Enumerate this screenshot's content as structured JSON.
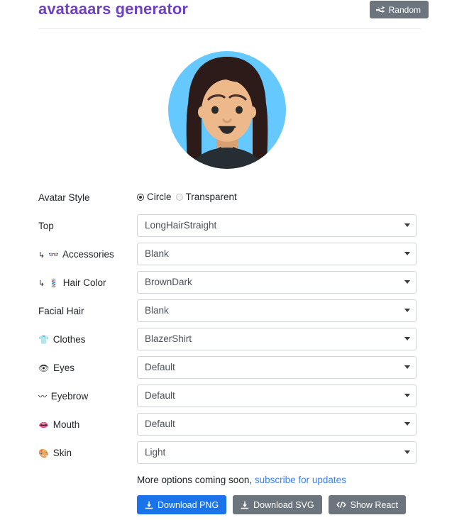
{
  "header": {
    "title": "avataaars generator",
    "random_button": {
      "label": "Random",
      "icon": "shuffle-icon",
      "bg": "#6c757d"
    },
    "title_color": "#6f42c1"
  },
  "avatar": {
    "alt": "generated avatar preview",
    "background_color": "#65C9FF",
    "skin_color": "#EDB98A",
    "hair_color": "#2C1B18",
    "clothes_color": "#262E33"
  },
  "form": {
    "rows": [
      {
        "id": "avatar-style",
        "label": "Avatar Style",
        "icon": "",
        "sub": false,
        "type": "radio",
        "options": [
          "Circle",
          "Transparent"
        ],
        "value": "Circle"
      },
      {
        "id": "top",
        "label": "Top",
        "icon": "",
        "sub": false,
        "type": "select",
        "value": "LongHairStraight"
      },
      {
        "id": "accessories",
        "label": "Accessories",
        "icon": "👓",
        "icon_name": "glasses-icon",
        "sub": true,
        "type": "select",
        "value": "Blank"
      },
      {
        "id": "hair-color",
        "label": "Hair Color",
        "icon": "💈",
        "icon_name": "hair-color-icon",
        "sub": true,
        "type": "select",
        "value": "BrownDark"
      },
      {
        "id": "facial-hair",
        "label": "Facial Hair",
        "icon": "",
        "sub": false,
        "type": "select",
        "value": "Blank"
      },
      {
        "id": "clothes",
        "label": "Clothes",
        "icon": "👕",
        "icon_name": "shirt-icon",
        "sub": false,
        "type": "select",
        "value": "BlazerShirt"
      },
      {
        "id": "eyes",
        "label": "Eyes",
        "icon": "👁",
        "icon_name": "eye-icon",
        "sub": false,
        "type": "select",
        "value": "Default"
      },
      {
        "id": "eyebrow",
        "label": "Eyebrow",
        "icon": "〰",
        "icon_name": "eyebrow-icon",
        "sub": false,
        "type": "select",
        "value": "Default"
      },
      {
        "id": "mouth",
        "label": "Mouth",
        "icon": "👄",
        "icon_name": "mouth-icon",
        "sub": false,
        "type": "select",
        "value": "Default"
      },
      {
        "id": "skin",
        "label": "Skin",
        "icon": "🎨",
        "icon_name": "palette-icon",
        "sub": false,
        "type": "select",
        "value": "Light"
      }
    ],
    "sub_arrow": "↳"
  },
  "footer": {
    "note_text": "More options coming soon, ",
    "note_link": "subscribe for updates",
    "buttons": [
      {
        "id": "download-png",
        "label": "Download PNG",
        "icon": "download-icon",
        "style": "primary"
      },
      {
        "id": "download-svg",
        "label": "Download SVG",
        "icon": "download-icon",
        "style": "secondary"
      },
      {
        "id": "show-react",
        "label": "Show React",
        "icon": "code-icon",
        "style": "secondary"
      }
    ]
  }
}
